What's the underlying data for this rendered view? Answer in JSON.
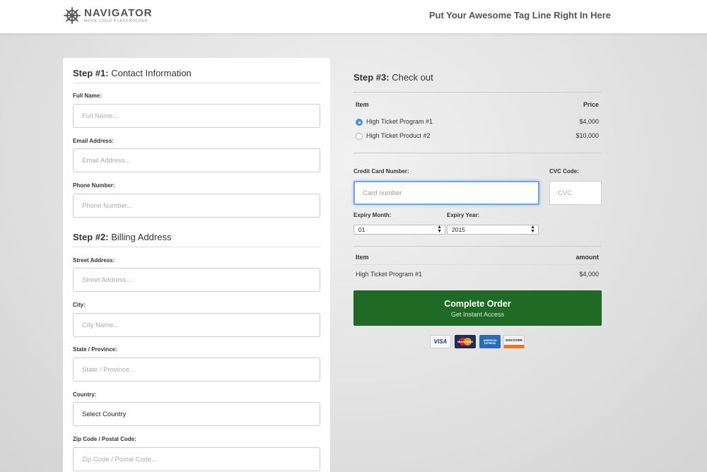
{
  "header": {
    "logo_title": "NAVIGATOR",
    "logo_subtitle": "MOCK LOGO PLACEHOLDER",
    "tagline": "Put Your Awesome Tag Line Right In Here"
  },
  "step1": {
    "num": "Step #1:",
    "title": "Contact Information",
    "fields": [
      {
        "label": "Full Name:",
        "placeholder": "Full Name..."
      },
      {
        "label": "Email Address:",
        "placeholder": "Email Address..."
      },
      {
        "label": "Phone Number:",
        "placeholder": "Phone Number..."
      }
    ]
  },
  "step2": {
    "num": "Step #2:",
    "title": "Billing Address",
    "fields": [
      {
        "label": "Street Address:",
        "placeholder": "Street Address...."
      },
      {
        "label": "City:",
        "placeholder": "City Name..."
      },
      {
        "label": "State / Province:",
        "placeholder": "State / Province..."
      }
    ],
    "country_label": "Country:",
    "country_value": "Select Country",
    "zip_label": "Zip Code / Postal Code:",
    "zip_placeholder": "Zip Code / Postal Code..."
  },
  "step3": {
    "num": "Step #3:",
    "title": "Check out",
    "col_item": "Item",
    "col_price": "Price",
    "products": [
      {
        "name": "High Ticket Program #1",
        "price": "$4,000",
        "selected": true
      },
      {
        "name": "High Ticket Product #2",
        "price": "$10,000",
        "selected": false
      }
    ],
    "card_label": "Credit Card Number:",
    "card_placeholder": "Card number",
    "cvc_label": "CVC Code:",
    "cvc_placeholder": "CVC",
    "expiry_month_label": "Expiry Month:",
    "expiry_month_value": "01",
    "expiry_year_label": "Expiry Year:",
    "expiry_year_value": "2015",
    "summary_item_header": "Item",
    "summary_amount_header": "amount",
    "summary_item": "High Ticket Program #1",
    "summary_amount": "$4,000",
    "button_main": "Complete Order",
    "button_sub": "Get Instant Access",
    "card_brands": [
      "VISA",
      "MasterCard",
      "AMERICAN EXPRESS",
      "DISCOVER"
    ]
  },
  "colors": {
    "button_green": "#1f6b26",
    "radio_blue": "#4a90e2",
    "focus_border": "#6ea8e8"
  }
}
